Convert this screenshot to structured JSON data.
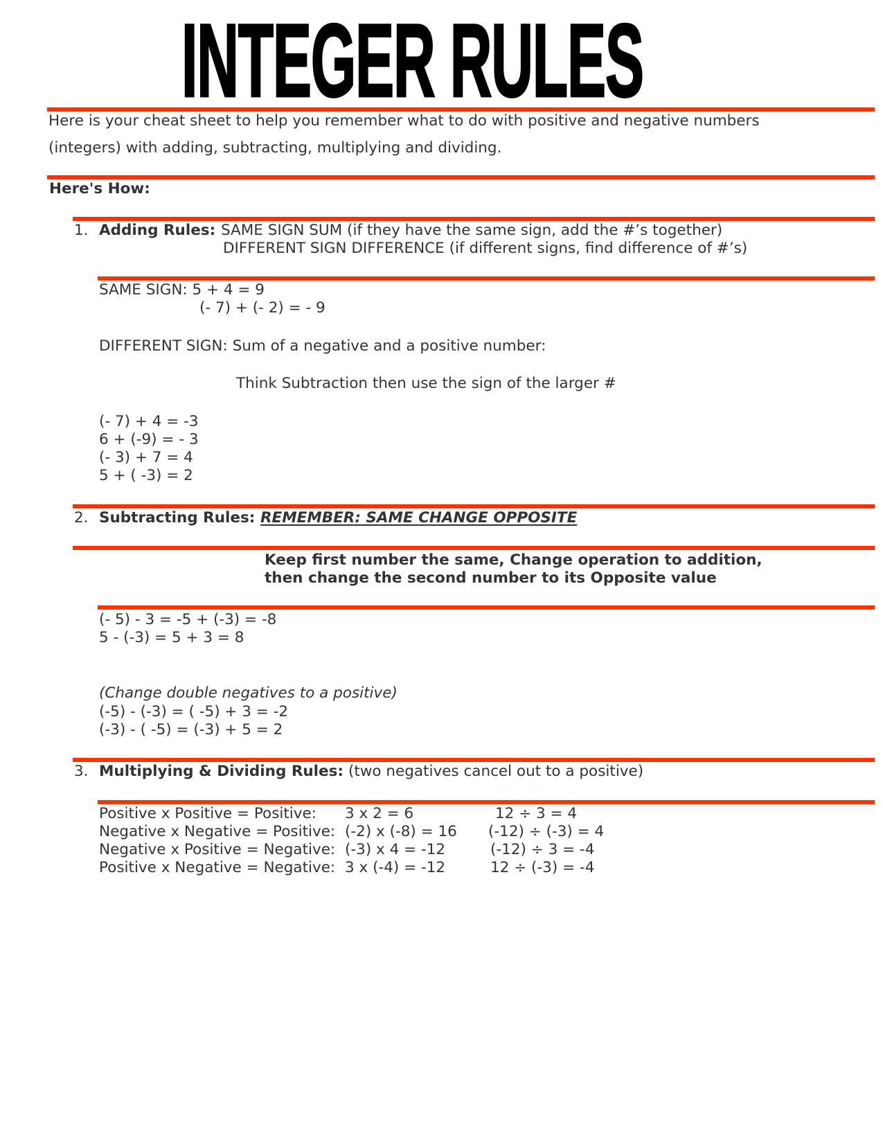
{
  "page": {
    "title": "INTEGER RULES",
    "accent_color": "#ff3300",
    "intro": [
      "Here is your cheat sheet to help you remember what to do with positive and negative numbers",
      "(integers) with adding, subtracting, multiplying and dividing."
    ],
    "heres_how": "Here's How:"
  },
  "adding": {
    "number": "1.",
    "heading": "Adding Rules:",
    "rule1": "SAME SIGN SUM (if they have the same sign, add the #’s together)",
    "rule2": "DIFFERENT SIGN DIFFERENCE (if different signs, find difference of #’s)",
    "same_sign_label": "SAME SIGN: 5 + 4 = 9",
    "same_sign_example2": "(- 7) + (- 2) = - 9",
    "different_sign_label": "DIFFERENT SIGN: Sum of a negative and a positive number:",
    "think": "Think Subtraction then use the sign of the larger #",
    "examples": [
      "(- 7) + 4 = -3",
      "6 + (-9) = - 3",
      "(- 3) + 7 = 4",
      "5 + ( -3) = 2"
    ]
  },
  "subtracting": {
    "number": "2.",
    "heading": "Subtracting Rules:",
    "remember": "REMEMBER: SAME CHANGE OPPOSITE",
    "keep_line1": "Keep first number the same, Change operation to addition,",
    "keep_line2": "then change the second number to its Opposite value",
    "examples": [
      "(- 5) - 3 = -5 + (-3) = -8",
      "5 - (-3) = 5 + 3 = 8"
    ],
    "double_neg_note": "(Change double negatives to a positive)",
    "double_neg_examples": [
      "(-5) - (-3) = ( -5) + 3 = -2",
      "(-3) - ( -5) = (-3) + 5 = 2"
    ]
  },
  "multiplying": {
    "number": "3.",
    "heading": "Multiplying & Dividing Rules:",
    "note": "(two negatives cancel out to a positive)",
    "rows": [
      {
        "rule": "Positive x Positive = Positive:",
        "mult": "3 x 2 = 6",
        "div": "12 ÷ 3 = 4"
      },
      {
        "rule": "Negative x Negative = Positive:",
        "mult": "(-2) x (-8) = 16",
        "div": "(-12) ÷ (-3) = 4"
      },
      {
        "rule": "Negative x Positive = Negative:",
        "mult": "(-3) x 4 = -12",
        "div": "(-12) ÷ 3 = -4"
      },
      {
        "rule": "Positive x Negative = Negative:",
        "mult": "3 x (-4) = -12",
        "div": "12 ÷ (-3) = -4"
      }
    ]
  }
}
